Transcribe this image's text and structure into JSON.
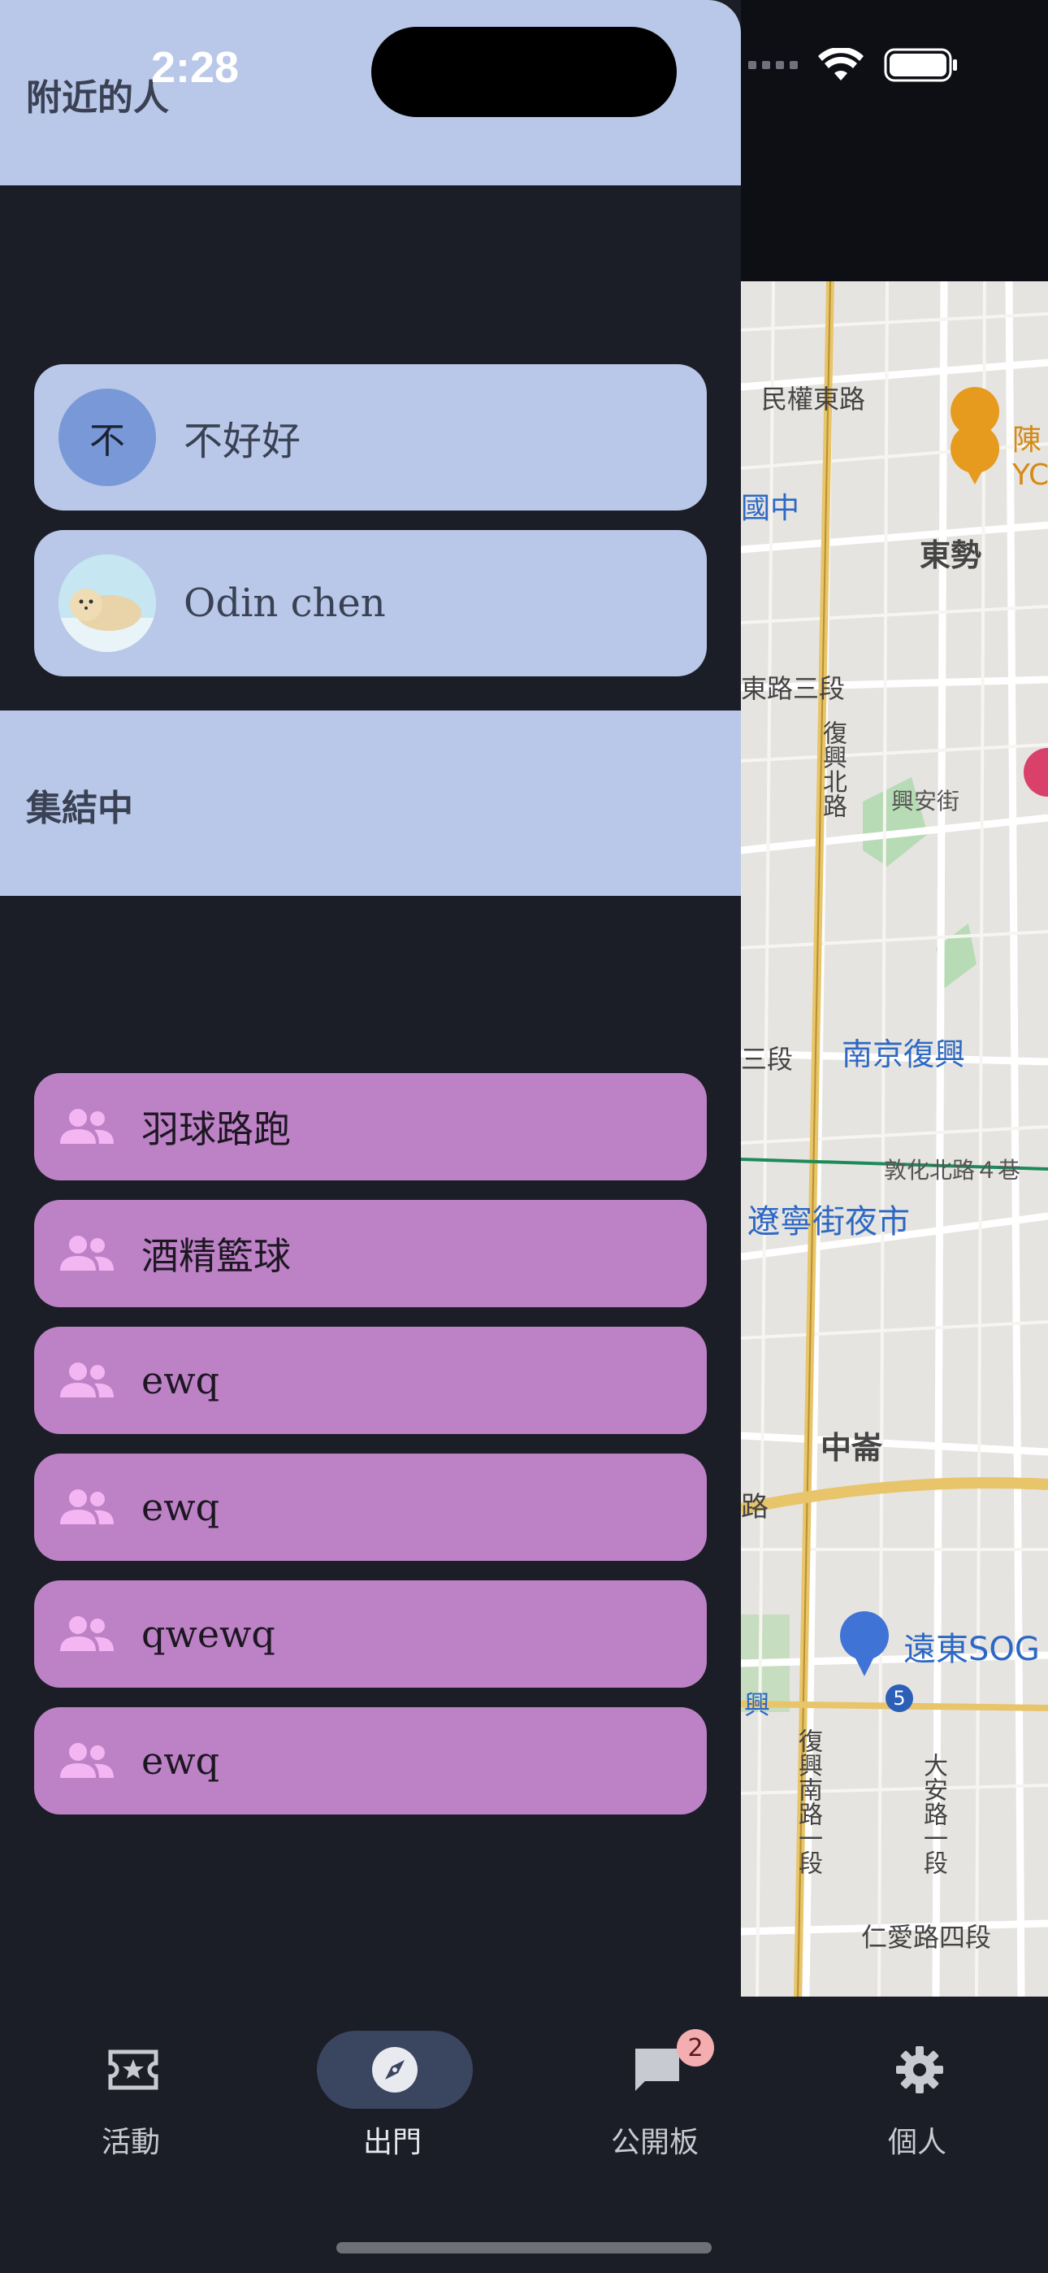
{
  "status_bar": {
    "time": "2:28"
  },
  "nearby": {
    "title": "附近的人",
    "people": [
      {
        "name": "不好好",
        "avatar_letter": "不"
      },
      {
        "name": "Odin chen",
        "avatar": "seal-photo"
      }
    ]
  },
  "gathering": {
    "title": "集結中",
    "groups": [
      {
        "name": "羽球路跑",
        "icon": "group-icon"
      },
      {
        "name": "酒精籃球",
        "icon": "group-icon"
      },
      {
        "name": "ewq",
        "icon": "group-icon"
      },
      {
        "name": "ewq",
        "icon": "group-icon"
      },
      {
        "name": "qwewq",
        "icon": "group-icon"
      },
      {
        "name": "ewq",
        "icon": "group-icon"
      }
    ]
  },
  "map": {
    "labels": [
      "民權東路",
      "陳",
      "YC",
      "國中",
      "東勢",
      "東路三段",
      "復興北路",
      "興安街",
      "三段",
      "南京復興",
      "敦化北路４巷",
      "遼寧街夜市",
      "中崙",
      "路",
      "遠東SOG",
      "興",
      "5",
      "復興南路一段",
      "大安路一段",
      "仁愛路四段"
    ]
  },
  "bottom_nav": {
    "items": [
      {
        "label": "活動",
        "icon": "ticket-star-icon"
      },
      {
        "label": "出門",
        "icon": "compass-icon",
        "active": true
      },
      {
        "label": "公開板",
        "icon": "chat-bubble-icon",
        "badge": "2"
      },
      {
        "label": "個人",
        "icon": "gear-icon"
      }
    ]
  },
  "colors": {
    "background": "#1b1e26",
    "header": "#b9c8e8",
    "person_card": "#b9c8e8",
    "group_card": "#bd82c6",
    "active_nav": "#3a4560",
    "badge": "#f4aeb0"
  }
}
